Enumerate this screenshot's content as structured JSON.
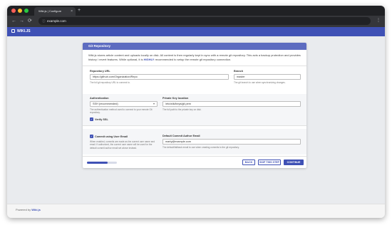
{
  "browser": {
    "tab_title": "Wiki.js | Configure",
    "tab_close": "×",
    "new_tab": "+",
    "url": "example.com",
    "back": "←",
    "forward": "→",
    "reload": "⟳",
    "menu": "⋮",
    "lock": "ⓘ"
  },
  "app": {
    "logo_text": "WIKI.JS"
  },
  "card": {
    "header": "Git Repository",
    "intro_before": "Wiki.js stores article content and uploads locally on disk. All content is then regularly kept in sync with a remote git repository. This acts a backup protection and provides history / revert features. While optional, it is ",
    "intro_highlight": "HIGHLY",
    "intro_after": " recommended to setup the remote git repository connection."
  },
  "fields": {
    "repo_url_label": "Repository URL",
    "repo_url_value": "https://github.com/Organization/Repo",
    "repo_url_hint": "The full git repository URL to connect to.",
    "branch_label": "Branch",
    "branch_value": "master",
    "branch_hint": "The git branch to use when synchronizing changes.",
    "auth_label": "Authentication",
    "auth_value": "SSH (recommended)",
    "auth_hint": "The authentication method used to connect to your remote Git repository.",
    "key_label": "Private Key location",
    "key_value": "/etc/wiki/keys/git.pem",
    "key_hint": "The full path to the private key on disk.",
    "verify_ssl_label": "Verify SSL",
    "commit_user_label": "Commit using User Email",
    "commit_user_hint": "When enabled, commits are made as the current user name and email. If authorized, the current user name will be used for the default commit author email set above instead.",
    "default_email_label": "Default Commit Author Email",
    "default_email_value": "marty@example.com",
    "default_email_hint": "The default/fallback email to use when creating commits to the git repository."
  },
  "progress": {
    "fraction": 0.7
  },
  "buttons": {
    "back": "BACK",
    "skip": "SKIP THIS STEP",
    "continue": "CONTINUE"
  },
  "footer": {
    "prefix": "Powered by",
    "brand": "Wiki.js"
  },
  "colors": {
    "accent": "#3f51b5",
    "header": "#5c6bc0"
  }
}
